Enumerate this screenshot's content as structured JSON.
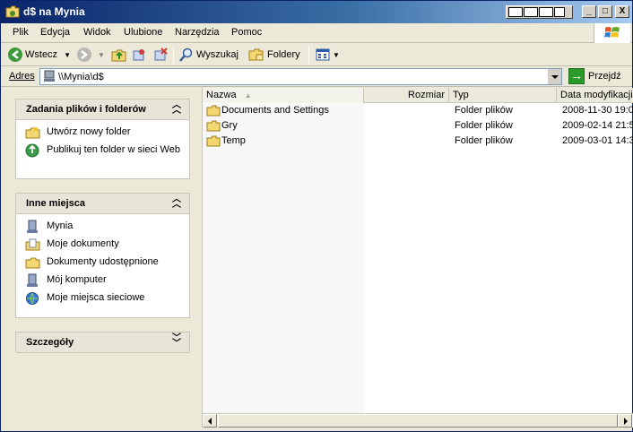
{
  "window": {
    "title": "d$ na Mynia",
    "minimize": "_",
    "maximize": "□",
    "close": "X"
  },
  "menu": {
    "items": [
      "Plik",
      "Edycja",
      "Widok",
      "Ulubione",
      "Narzędzia",
      "Pomoc"
    ]
  },
  "toolbar": {
    "back_label": "Wstecz",
    "search_label": "Wyszukaj",
    "folders_label": "Foldery"
  },
  "address": {
    "label": "Adres",
    "value": "\\\\Mynia\\d$",
    "go_label": "Przejdź"
  },
  "taskpane": {
    "file_tasks": {
      "title": "Zadania plików i folderów",
      "items": [
        {
          "label": "Utwórz nowy folder",
          "icon": "new-folder-icon"
        },
        {
          "label": "Publikuj ten folder w sieci Web",
          "icon": "publish-web-icon"
        }
      ]
    },
    "other_places": {
      "title": "Inne miejsca",
      "items": [
        {
          "label": "Mynia",
          "icon": "computer-icon"
        },
        {
          "label": "Moje dokumenty",
          "icon": "my-documents-icon"
        },
        {
          "label": "Dokumenty udostępnione",
          "icon": "shared-folder-icon"
        },
        {
          "label": "Mój komputer",
          "icon": "computer-icon"
        },
        {
          "label": "Moje miejsca sieciowe",
          "icon": "network-icon"
        }
      ]
    },
    "details": {
      "title": "Szczegóły"
    }
  },
  "filelist": {
    "columns": [
      "Nazwa",
      "Rozmiar",
      "Typ",
      "Data modyfikacji"
    ],
    "rows": [
      {
        "name": "Documents and Settings",
        "size": "",
        "type": "Folder plików",
        "date": "2008-11-30 19:0"
      },
      {
        "name": "Gry",
        "size": "",
        "type": "Folder plików",
        "date": "2009-02-14 21:5"
      },
      {
        "name": "Temp",
        "size": "",
        "type": "Folder plików",
        "date": "2009-03-01 14:3"
      }
    ]
  },
  "colors": {
    "titlebar_start": "#0a246a",
    "titlebar_end": "#a6caf0",
    "chrome": "#ece9d8",
    "folder": "#f2d772"
  }
}
